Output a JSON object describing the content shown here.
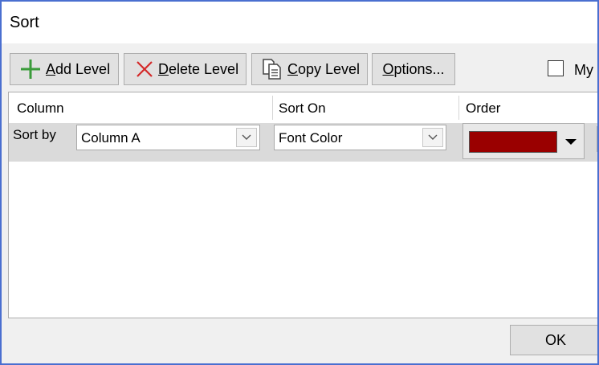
{
  "window": {
    "title": "Sort"
  },
  "toolbar": {
    "add": {
      "mnemonic": "A",
      "rest": "dd Level",
      "icon": "plus-icon"
    },
    "delete": {
      "mnemonic": "D",
      "rest": "elete Level",
      "icon": "x-icon"
    },
    "copy": {
      "mnemonic": "C",
      "rest": "opy Level",
      "icon": "copy-icon"
    },
    "options": {
      "mnemonic": "O",
      "rest": "ptions..."
    },
    "header_checkbox_label": "My"
  },
  "grid": {
    "columns": [
      "Column",
      "Sort On",
      "Order"
    ],
    "rows": [
      {
        "label": "Sort by",
        "column": "Column A",
        "sort_on": "Font Color",
        "order_color": "#9a0000"
      }
    ]
  },
  "footer": {
    "ok": "OK"
  },
  "colors": {
    "add_icon": "#3a9b3a",
    "delete_icon": "#d42a2a",
    "window_border": "#4a6fd0"
  }
}
